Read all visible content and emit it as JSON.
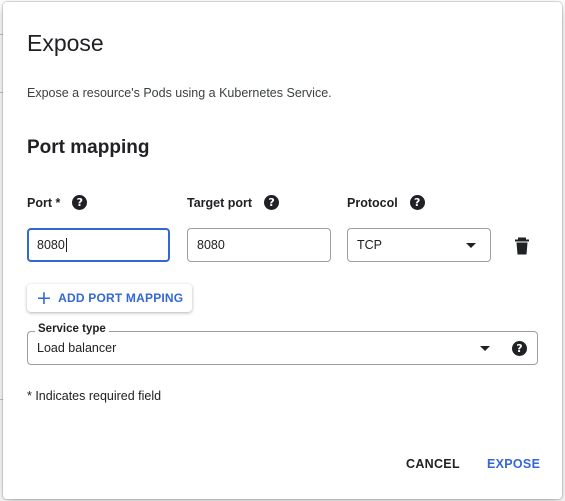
{
  "dialog": {
    "title": "Expose",
    "subtitle": "Expose a resource's Pods using a Kubernetes Service."
  },
  "port_mapping": {
    "section_title": "Port mapping",
    "columns": {
      "port_label": "Port *",
      "target_port_label": "Target port",
      "protocol_label": "Protocol"
    },
    "rows": [
      {
        "port": "8080",
        "target_port": "8080",
        "protocol": "TCP"
      }
    ],
    "add_button_label": "ADD PORT MAPPING"
  },
  "service_type": {
    "label": "Service type",
    "value": "Load balancer"
  },
  "required_note": "* Indicates required field",
  "actions": {
    "cancel_label": "CANCEL",
    "expose_label": "EXPOSE"
  },
  "colors": {
    "accent": "#3367d6",
    "text": "#202124",
    "border": "#9aa0a6"
  },
  "icons": {
    "help": "help-circle-icon",
    "delete": "trash-icon",
    "add": "plus-icon",
    "dropdown": "dropdown-arrow-icon"
  }
}
